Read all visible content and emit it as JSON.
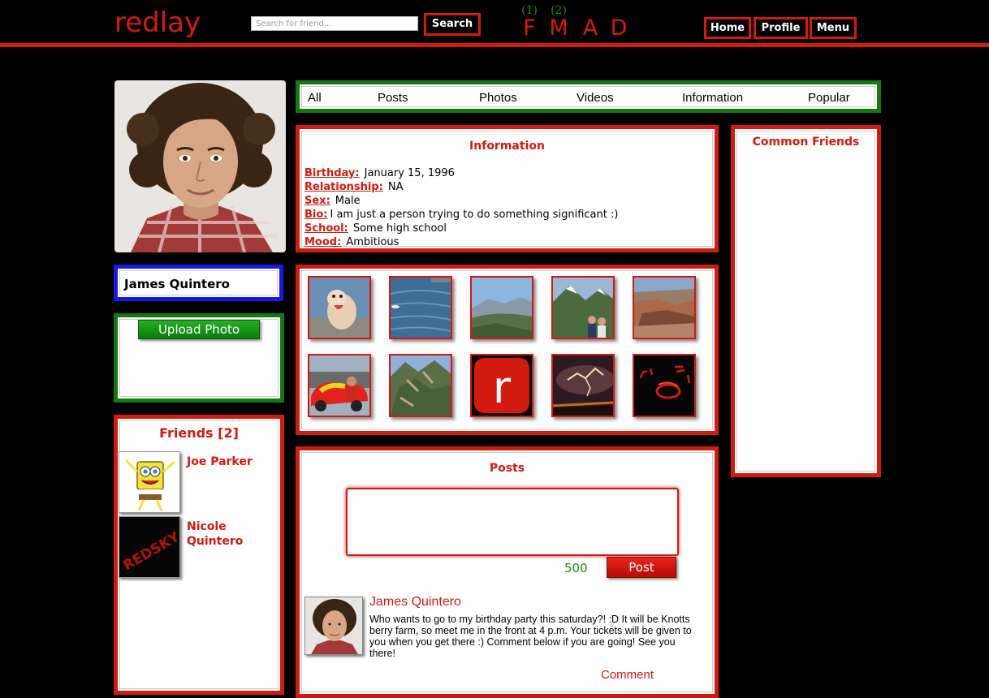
{
  "header": {
    "logo": "redlay",
    "search_placeholder": "Search for friend...",
    "search_button": "Search",
    "notifications": [
      {
        "count": "(1)",
        "letter": "F"
      },
      {
        "count": "(2)",
        "letter": "M"
      },
      {
        "count": "",
        "letter": "A"
      },
      {
        "count": "",
        "letter": "D"
      }
    ],
    "nav": {
      "home": "Home",
      "profile": "Profile",
      "menu": "Menu"
    }
  },
  "sidebar": {
    "profile_name": "James Quintero",
    "upload_button": "Upload Photo",
    "friends_title": "Friends [2]",
    "friends": [
      {
        "name": "Joe Parker",
        "icon": "spongebob-avatar"
      },
      {
        "name": "Nicole Quintero",
        "icon": "redsky-avatar"
      }
    ]
  },
  "tabs": [
    "All",
    "Posts",
    "Photos",
    "Videos",
    "Information",
    "Popular"
  ],
  "information": {
    "title": "Information",
    "rows": [
      {
        "label": "Birthday:",
        "value": "January 15, 1996"
      },
      {
        "label": "Relationship:",
        "value": "NA"
      },
      {
        "label": "Sex:",
        "value": "Male"
      },
      {
        "label": "Bio:",
        "value": "I am just a person trying to do something significant :)"
      },
      {
        "label": "School:",
        "value": "Some high school"
      },
      {
        "label": "Mood:",
        "value": "Ambitious"
      }
    ]
  },
  "photos": [
    "dog-photo",
    "lake-photo",
    "mountain-valley-photo",
    "mountain-couple-photo",
    "canyon-photo",
    "car-photo",
    "forest-mountain-photo",
    "redlay-logo-photo",
    "lightning-photo",
    "dark-red-photo"
  ],
  "posts": {
    "title": "Posts",
    "textarea_value": "",
    "char_count": "500",
    "post_button": "Post",
    "items": [
      {
        "author": "James Quintero",
        "text": "Who wants to go to my birthday party this saturday?! :D It will be Knotts berry farm, so meet me in the front at 4 p.m. Your tickets will be given to you when you get there :) Comment below if you are going! See you there!",
        "comment_label": "Comment"
      }
    ]
  },
  "common_friends": {
    "title": "Common Friends"
  },
  "colors": {
    "accent": "#d21a0f",
    "green": "#14790f",
    "blue": "#1717e6",
    "background": "#000000"
  }
}
